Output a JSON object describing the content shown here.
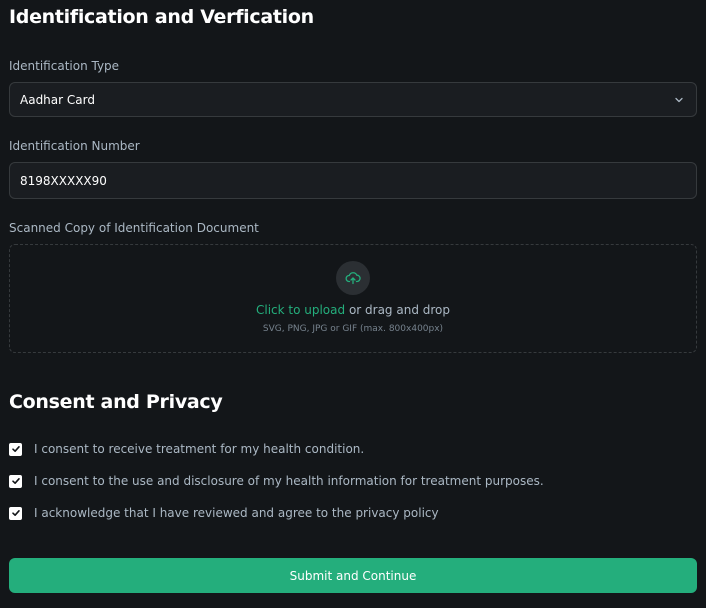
{
  "identification": {
    "heading": "Identification and Verfication",
    "type_label": "Identification Type",
    "type_value": "Aadhar Card",
    "number_label": "Identification Number",
    "number_value": "8198XXXXX90",
    "document_label": "Scanned Copy of Identification Document",
    "upload": {
      "link_text": "Click to upload",
      "rest_text": " or drag and drop",
      "hint": "SVG, PNG, JPG or GIF (max. 800x400px)",
      "icon": "upload-cloud-icon"
    }
  },
  "consent": {
    "heading": "Consent and Privacy",
    "items": [
      {
        "label": "I consent to receive treatment for my health condition.",
        "checked": true
      },
      {
        "label": "I consent to the use and disclosure of my health information for treatment purposes.",
        "checked": true
      },
      {
        "label": "I acknowledge that I have reviewed and agree to the privacy policy",
        "checked": true
      }
    ]
  },
  "submit": {
    "label": "Submit and Continue"
  },
  "colors": {
    "background": "#131619",
    "field": "#1a1d21",
    "border": "#363a3d",
    "accent": "#24ae7c",
    "muted_text": "#abb8c4"
  }
}
